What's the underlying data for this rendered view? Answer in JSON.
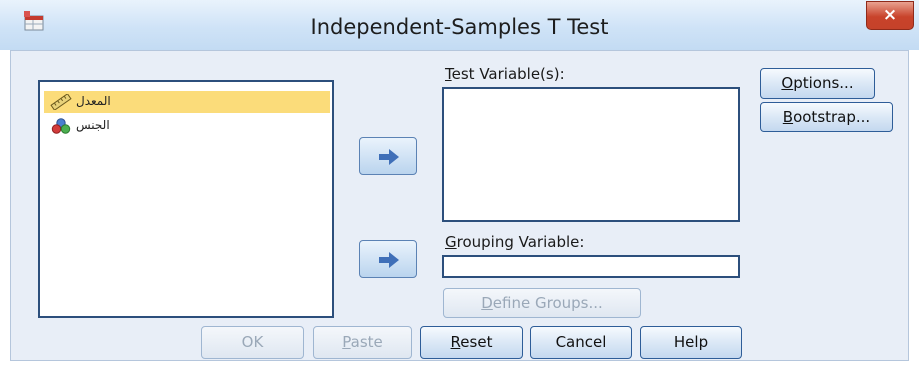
{
  "window": {
    "title": "Independent-Samples T Test",
    "close_glyph": "×",
    "app_icon": "spss-dialog-icon"
  },
  "source_variables": [
    {
      "label": "المعدل",
      "icon": "scale-ruler-icon",
      "selected": true
    },
    {
      "label": "الجنس",
      "icon": "nominal-circles-icon",
      "selected": false
    }
  ],
  "test_variables": {
    "label_mnemonic": "T",
    "label_rest": "est Variable(s):"
  },
  "grouping_variable": {
    "label_mnemonic": "G",
    "label_rest": "rouping Variable:",
    "value": ""
  },
  "buttons": {
    "options": {
      "mnemonic": "O",
      "rest": "ptions..."
    },
    "bootstrap": {
      "mnemonic": "B",
      "rest": "ootstrap..."
    },
    "define_groups": {
      "mnemonic": "D",
      "rest": "efine Groups..."
    },
    "ok": "OK",
    "paste": {
      "mnemonic": "P",
      "rest": "aste"
    },
    "reset": {
      "mnemonic": "R",
      "rest": "eset"
    },
    "cancel": "Cancel",
    "help": "Help"
  },
  "colors": {
    "selection": "#fbdc7a",
    "close_button": "#c8432b",
    "dialog_bg": "#e8eef7"
  }
}
